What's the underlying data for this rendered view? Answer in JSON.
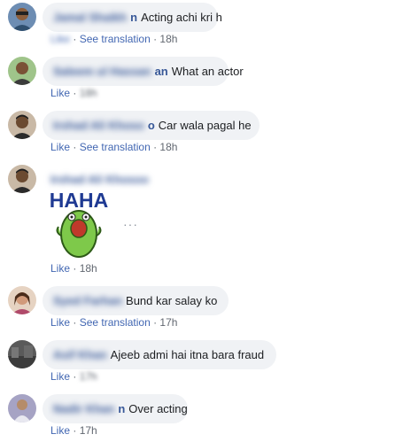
{
  "comments": [
    {
      "name": "Jamal Shaikh",
      "suffix": "n",
      "text": "Acting achi kri h",
      "like": "Like",
      "translate": "See translation",
      "sep": " · ",
      "time": "18h"
    },
    {
      "name": "Saleem ul Hassan",
      "suffix": "an",
      "text": "What an actor",
      "like": "Like",
      "sep": " · ",
      "time": "18h"
    },
    {
      "name": "Irshad Ali Khoso",
      "suffix": "o",
      "text": "Car wala pagal he",
      "like": "Like",
      "translate": "See translation",
      "sep": " · ",
      "time": "18h"
    },
    {
      "name": "Irshad Ali Khoso",
      "suffix": "o",
      "sticker": "HAHA",
      "like": "Like",
      "sep": " · ",
      "time": "18h",
      "dots": "···"
    },
    {
      "name": "Syed Farhan",
      "suffix": "",
      "text": "Bund kar salay ko",
      "like": "Like",
      "translate": "See translation",
      "sep": " · ",
      "time": "17h"
    },
    {
      "name": "Asif Khan",
      "suffix": "",
      "text": "Ajeeb admi hai itna bara fraud",
      "like": "Like",
      "sep": " · ",
      "time": "17h"
    },
    {
      "name": "Nadir Khan",
      "suffix": "n",
      "text": "Over acting",
      "like": "Like",
      "sep": " · ",
      "time": "17h"
    }
  ],
  "colors": {
    "link": "#4267b2",
    "name": "#385898",
    "bubble": "#f0f2f5",
    "meta": "#616770"
  }
}
